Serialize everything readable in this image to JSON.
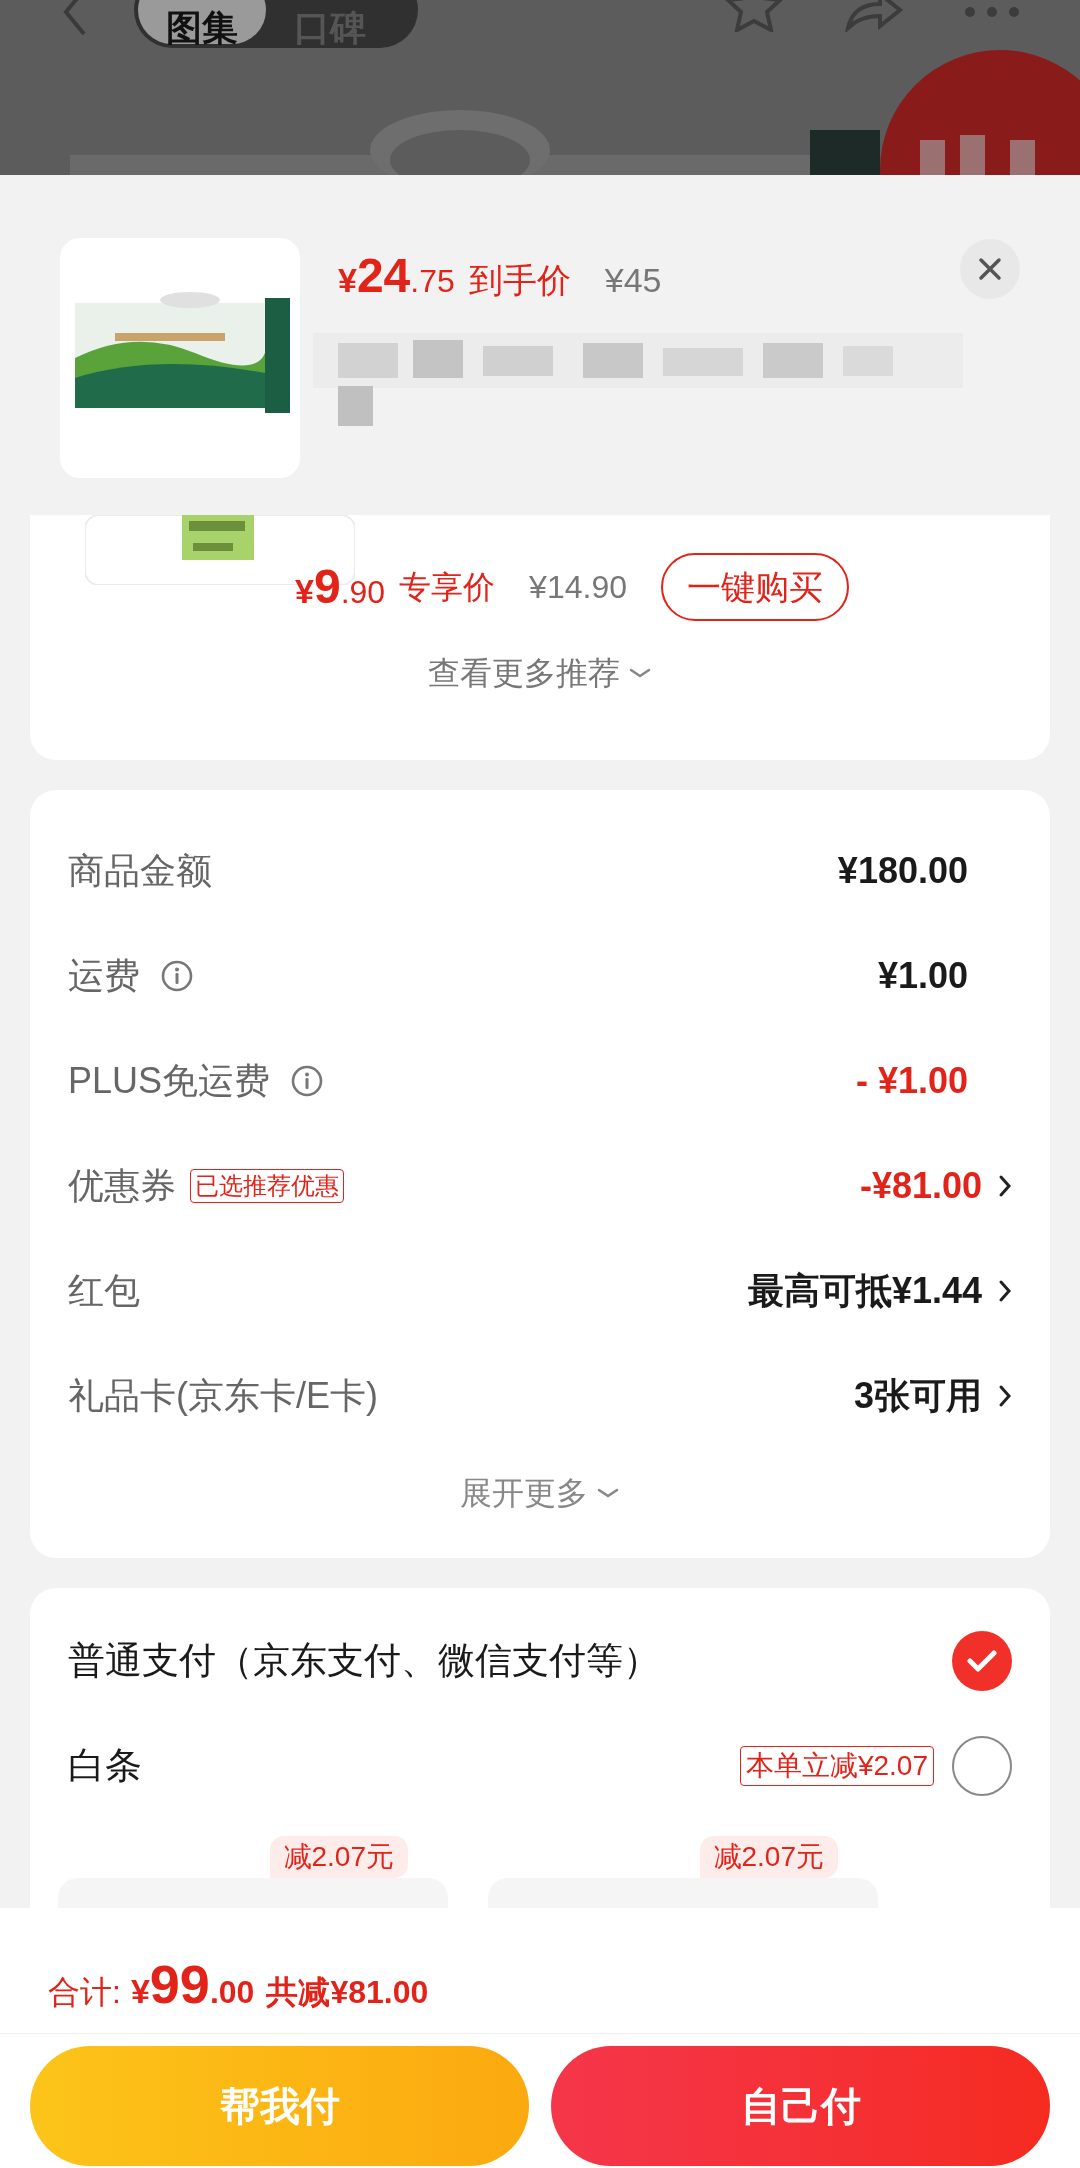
{
  "top_bar": {
    "tabs": [
      {
        "label": "图集",
        "selected": true
      },
      {
        "label": "口碑",
        "selected": false
      }
    ]
  },
  "product": {
    "price_symbol": "¥",
    "price_int": "24",
    "price_dec": ".75",
    "price_label": "到手价",
    "original_price": "¥45"
  },
  "recommendation": {
    "price_symbol": "¥",
    "price_int": "9",
    "price_dec": ".90",
    "price_label": "专享价",
    "original_price": "¥14.90",
    "buy_button": "一键购买",
    "more_link": "查看更多推荐"
  },
  "summary": {
    "rows": [
      {
        "label": "商品金额",
        "value": "¥180.00",
        "kind": "plain",
        "info": false,
        "chevron": false
      },
      {
        "label": "运费",
        "value": "¥1.00",
        "kind": "plain",
        "info": true,
        "chevron": false
      },
      {
        "label": "PLUS免运费",
        "value": "- ¥1.00",
        "kind": "discount",
        "info": true,
        "chevron": false
      },
      {
        "label": "优惠券",
        "tag": "已选推荐优惠",
        "value": "-¥81.00",
        "kind": "discount",
        "info": false,
        "chevron": true
      },
      {
        "label": "红包",
        "value": "最高可抵¥1.44",
        "kind": "plain",
        "info": false,
        "chevron": true
      },
      {
        "label": "礼品卡(京东卡/E卡)",
        "value": "3张可用",
        "kind": "plain",
        "info": false,
        "chevron": true
      }
    ],
    "expand": "展开更多"
  },
  "payment": {
    "options": [
      {
        "label": "普通支付（京东支付、微信支付等）",
        "selected": true
      },
      {
        "label": "白条",
        "badge": "本单立减¥2.07",
        "selected": false
      }
    ],
    "offers": [
      {
        "tag": "减2.07元"
      },
      {
        "tag": "减2.07元"
      }
    ]
  },
  "footer": {
    "total_label": "合计:",
    "total_symbol": "¥",
    "total_int": "99",
    "total_dec": ".00",
    "saved": "共减¥81.00",
    "buttons": [
      {
        "label": "帮我付",
        "kind": "helper"
      },
      {
        "label": "自己付",
        "kind": "self"
      }
    ]
  }
}
